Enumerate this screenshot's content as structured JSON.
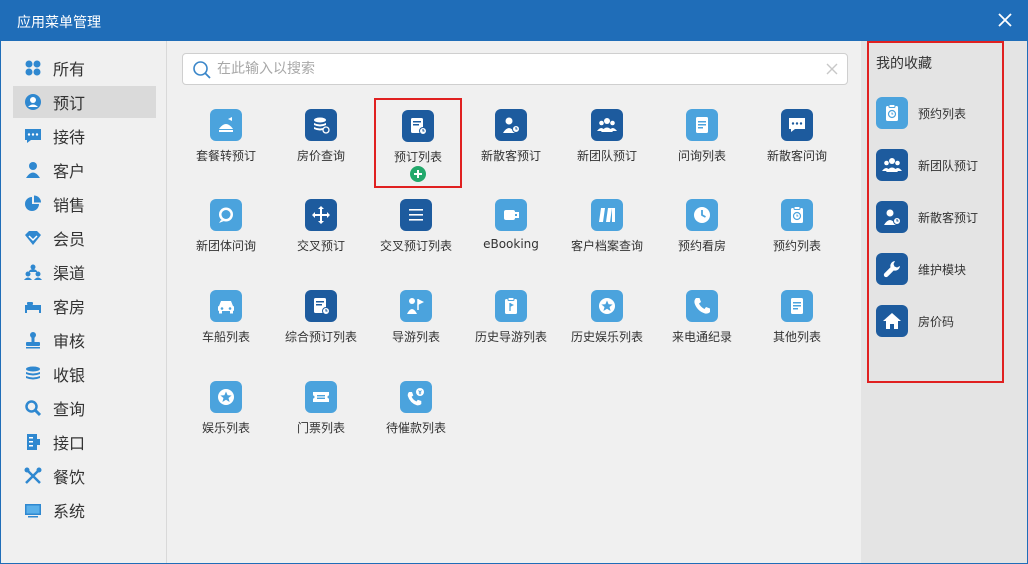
{
  "window": {
    "title": "应用菜单管理"
  },
  "sidebar": {
    "items": [
      {
        "label": "所有",
        "icon": "grid-dots-icon"
      },
      {
        "label": "预订",
        "icon": "user-circle-icon"
      },
      {
        "label": "接待",
        "icon": "chat-bubble-icon"
      },
      {
        "label": "客户",
        "icon": "person-icon"
      },
      {
        "label": "销售",
        "icon": "pie-chart-icon"
      },
      {
        "label": "会员",
        "icon": "diamond-icon"
      },
      {
        "label": "渠道",
        "icon": "group-icon"
      },
      {
        "label": "客房",
        "icon": "bed-icon"
      },
      {
        "label": "审核",
        "icon": "stamp-icon"
      },
      {
        "label": "收银",
        "icon": "coins-icon"
      },
      {
        "label": "查询",
        "icon": "magnifier-icon"
      },
      {
        "label": "接口",
        "icon": "interface-icon"
      },
      {
        "label": "餐饮",
        "icon": "fork-knife-icon"
      },
      {
        "label": "系统",
        "icon": "monitor-icon"
      }
    ],
    "active_index": 1
  },
  "search": {
    "placeholder": "在此输入以搜索",
    "value": ""
  },
  "tiles": [
    {
      "label": "套餐转预订",
      "icon": "package-icon",
      "tone": "light"
    },
    {
      "label": "房价查询",
      "icon": "price-query-icon",
      "tone": "dark"
    },
    {
      "label": "预订列表",
      "icon": "booking-list-icon",
      "tone": "dark"
    },
    {
      "label": "新散客预订",
      "icon": "individual-booking-icon",
      "tone": "light"
    },
    {
      "label": "新团队预订",
      "icon": "team-booking-icon",
      "tone": "light"
    },
    {
      "label": "问询列表",
      "icon": "inquiry-list-icon",
      "tone": "light"
    },
    {
      "label": "新散客问询",
      "icon": "individual-inquiry-icon",
      "tone": "light"
    },
    {
      "label": "新团体问询",
      "icon": "group-inquiry-icon",
      "tone": "light"
    },
    {
      "label": "交叉预订",
      "icon": "cross-arrows-icon",
      "tone": "dark"
    },
    {
      "label": "交叉预订列表",
      "icon": "cross-list-icon",
      "tone": "dark"
    },
    {
      "label": "eBooking",
      "icon": "ebooking-icon",
      "tone": "light"
    },
    {
      "label": "客户档案查询",
      "icon": "profile-search-icon",
      "tone": "light"
    },
    {
      "label": "预约看房",
      "icon": "clock-icon",
      "tone": "light"
    },
    {
      "label": "预约列表",
      "icon": "appointment-list-icon",
      "tone": "light"
    },
    {
      "label": "车船列表",
      "icon": "car-icon",
      "tone": "light"
    },
    {
      "label": "综合预订列表",
      "icon": "combined-list-icon",
      "tone": "dark"
    },
    {
      "label": "导游列表",
      "icon": "guide-flag-icon",
      "tone": "light"
    },
    {
      "label": "历史导游列表",
      "icon": "history-guide-icon",
      "tone": "light"
    },
    {
      "label": "历史娱乐列表",
      "icon": "history-star-icon",
      "tone": "light"
    },
    {
      "label": "来电通纪录",
      "icon": "phone-icon",
      "tone": "light"
    },
    {
      "label": "其他列表",
      "icon": "other-list-icon",
      "tone": "light"
    },
    {
      "label": "娱乐列表",
      "icon": "star-circle-icon",
      "tone": "light"
    },
    {
      "label": "门票列表",
      "icon": "ticket-icon",
      "tone": "light"
    },
    {
      "label": "待催款列表",
      "icon": "phone-money-icon",
      "tone": "light"
    }
  ],
  "selected_tile_index": 2,
  "favorites": {
    "title": "我的收藏",
    "items": [
      {
        "label": "预约列表",
        "icon": "appointment-list-icon",
        "tone": "light"
      },
      {
        "label": "新团队预订",
        "icon": "team-booking-icon",
        "tone": "dark"
      },
      {
        "label": "新散客预订",
        "icon": "individual-booking-icon",
        "tone": "dark"
      },
      {
        "label": "维护模块",
        "icon": "wrench-icon",
        "tone": "dark"
      },
      {
        "label": "房价码",
        "icon": "home-icon",
        "tone": "dark"
      }
    ]
  },
  "colors": {
    "titlebar": "#1f6db8",
    "icon_light": "#4ba3dd",
    "icon_dark": "#1d5b9e",
    "highlight": "#e02020",
    "add_badge": "#22a86b"
  }
}
